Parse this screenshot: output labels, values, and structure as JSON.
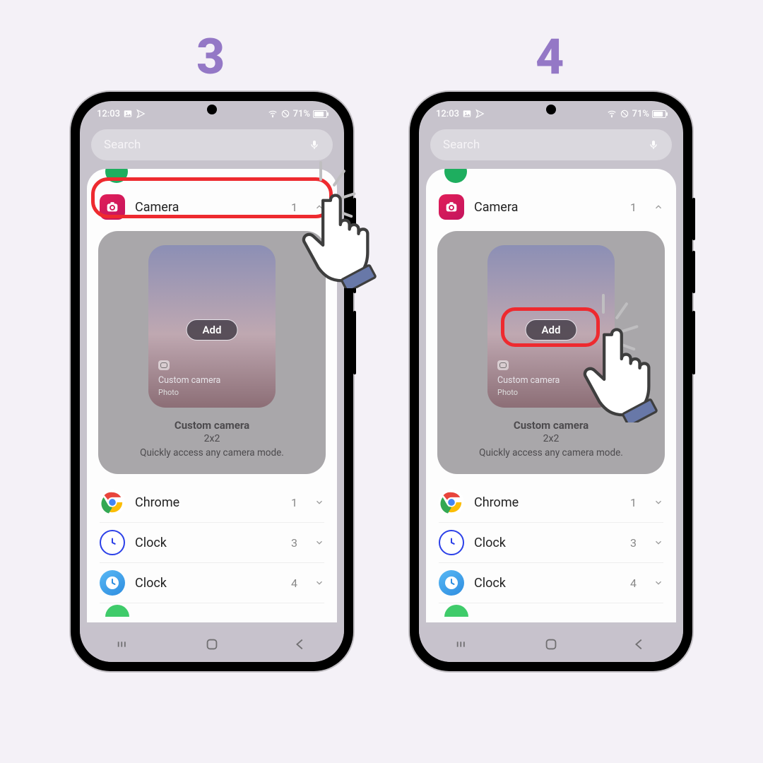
{
  "step_labels": {
    "left": "3",
    "right": "4"
  },
  "status": {
    "time": "12:03",
    "battery_percent": "71%"
  },
  "search": {
    "placeholder": "Search"
  },
  "items": {
    "camera": {
      "label": "Camera",
      "count": "1"
    },
    "chrome": {
      "label": "Chrome",
      "count": "1"
    },
    "clock_a": {
      "label": "Clock",
      "count": "3"
    },
    "clock_b": {
      "label": "Clock",
      "count": "4"
    }
  },
  "widget": {
    "add_label": "Add",
    "tile_title": "Custom camera",
    "tile_subtitle": "Photo",
    "name": "Custom camera",
    "size": "2x2",
    "desc": "Quickly access any camera mode."
  }
}
